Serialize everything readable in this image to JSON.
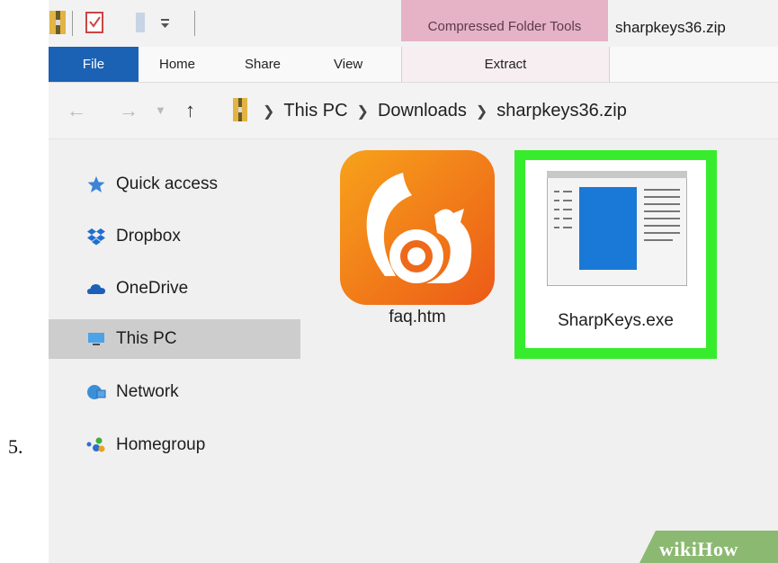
{
  "step_number": "5.",
  "title_bar": {
    "contextual_tab_header": "Compressed Folder Tools",
    "window_title": "sharpkeys36.zip"
  },
  "ribbon": {
    "tabs": [
      "File",
      "Home",
      "Share",
      "View"
    ],
    "contextual_tab": "Extract"
  },
  "address_bar": {
    "breadcrumbs": [
      "This PC",
      "Downloads",
      "sharpkeys36.zip"
    ]
  },
  "nav_pane": {
    "items": [
      {
        "label": "Quick access",
        "icon": "star-icon"
      },
      {
        "label": "Dropbox",
        "icon": "dropbox-icon"
      },
      {
        "label": "OneDrive",
        "icon": "cloud-icon"
      },
      {
        "label": "This PC",
        "icon": "computer-icon",
        "selected": true
      },
      {
        "label": "Network",
        "icon": "network-icon"
      },
      {
        "label": "Homegroup",
        "icon": "homegroup-icon"
      }
    ]
  },
  "files": [
    {
      "name": "faq.htm",
      "icon": "uc-browser-squirrel-icon"
    },
    {
      "name": "SharpKeys.exe",
      "icon": "application-window-icon",
      "highlighted": true
    }
  ],
  "colors": {
    "file_tab": "#1b62b4",
    "contextual_header": "#e6b2c6",
    "highlight": "#37ec2c",
    "selected_nav": "#cdcdcd"
  },
  "watermark": "wikiHow"
}
